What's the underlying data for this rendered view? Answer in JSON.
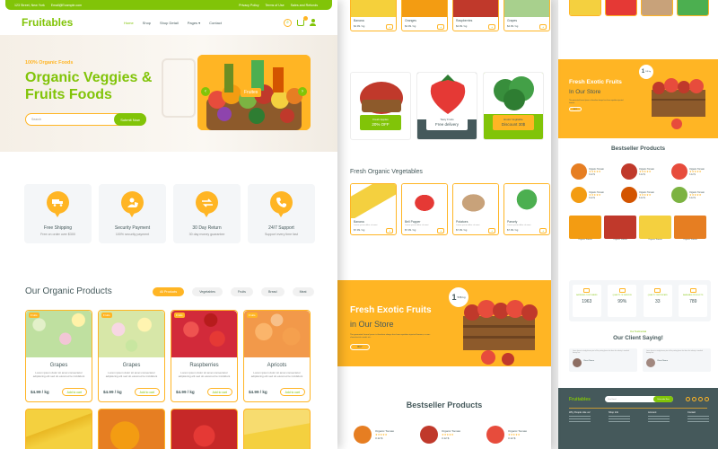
{
  "topbar": {
    "address": "123 Street, New York",
    "email": "Email@Example.com",
    "links": [
      "Privacy Policy",
      "Terms of Use",
      "Sales and Refunds"
    ]
  },
  "nav": {
    "logo": "Fruitables",
    "menu": [
      "Home",
      "Shop",
      "Shop Detail",
      "Pages ▾",
      "Contact"
    ],
    "cart_count": "3"
  },
  "hero": {
    "subtitle": "100% Organic Foods",
    "title": "Organic Veggies & Fruits Foods",
    "search_placeholder": "Search",
    "search_button": "Submit Now",
    "carousel_label": "Fruites"
  },
  "features": [
    {
      "title": "Free Shipping",
      "sub": "Free on order over $300",
      "icon": "truck-icon"
    },
    {
      "title": "Security Payment",
      "sub": "100% security payment",
      "icon": "user-shield-icon"
    },
    {
      "title": "30 Day Return",
      "sub": "30 day money guarantee",
      "icon": "exchange-icon"
    },
    {
      "title": "24/7 Support",
      "sub": "Support every time fast",
      "icon": "phone-icon"
    }
  ],
  "products_section": {
    "title": "Our Organic Products",
    "filters": [
      "All Products",
      "Vegetables",
      "Fruits",
      "Bread",
      "Meat"
    ]
  },
  "products": [
    {
      "tag": "Fruits",
      "name": "Grapes",
      "desc": "Lorem ipsum dolor sit amet consectetur adipisicing elit sed do eiusmod te incididunt",
      "price": "$4.99 / kg",
      "add": "Add to cart",
      "color": "#bfe0a0"
    },
    {
      "tag": "Fruits",
      "name": "Grapes",
      "desc": "Lorem ipsum dolor sit amet consectetur adipisicing elit sed do eiusmod te incididunt",
      "price": "$4.99 / kg",
      "add": "Add to cart",
      "color": "#d7e7a8"
    },
    {
      "tag": "Fruits",
      "name": "Raspberries",
      "desc": "Lorem ipsum dolor sit amet consectetur adipisicing elit sed do eiusmod te incididunt",
      "price": "$4.99 / kg",
      "add": "Add to cart",
      "color": "#d22a3a"
    },
    {
      "tag": "Fruits",
      "name": "Apricots",
      "desc": "Lorem ipsum dolor sit amet consectetur adipisicing elit sed do eiusmod te incididunt",
      "price": "$4.99 / kg",
      "add": "Add to cart",
      "color": "#f2994a"
    }
  ],
  "panel2": {
    "top_products": [
      {
        "name": "Banana",
        "price": "$4.99 / kg",
        "color": "#f5d03b"
      },
      {
        "name": "Oranges",
        "price": "$4.99 / kg",
        "color": "#f39c12"
      },
      {
        "name": "Raspberries",
        "price": "$4.99 / kg",
        "color": "#c0392b"
      },
      {
        "name": "Grapes",
        "price": "$4.99 / kg",
        "color": "#a8d08d"
      }
    ],
    "banners": [
      {
        "top": "Fresh Apples",
        "main": "20% OFF",
        "bg": "#ffffff",
        "lbl_bg": "#81c408",
        "lbl_color": "#ffffff",
        "fruit": "#c0392b"
      },
      {
        "top": "Tasty Fruits",
        "main": "Free delivery",
        "bg": "#45595b",
        "lbl_bg": "#ffffff",
        "lbl_color": "#45595b",
        "fruit": "#e74c3c"
      },
      {
        "top": "Exotic Vegitable",
        "main": "Discount 30$",
        "bg": "#81c408",
        "lbl_bg": "#ffb524",
        "lbl_color": "#45595b",
        "fruit": "#4caf50"
      }
    ],
    "veg_title": "Fresh Organic Vegetables",
    "veg": [
      {
        "name": "Banana",
        "price": "$7.99 / kg",
        "color": "#f4d03f"
      },
      {
        "name": "Bell Papper",
        "price": "$7.99 / kg",
        "color": "#e53935"
      },
      {
        "name": "Potatoes",
        "price": "$7.99 / kg",
        "color": "#c8a27a"
      },
      {
        "name": "Parsely",
        "price": "$7.99 / kg",
        "color": "#4caf50"
      }
    ],
    "exotic": {
      "title": "Fresh Exotic Fruits",
      "sub": "in Our Store",
      "btn": "BUY",
      "badge": "1",
      "badge_unit": "50$ kg"
    },
    "bestseller": "Bestseller Products",
    "best_items": [
      {
        "name": "Organic Tomato",
        "price": "3.12 $",
        "color": "#e67e22"
      },
      {
        "name": "Organic Tomato",
        "price": "3.12 $",
        "color": "#c0392b"
      },
      {
        "name": "Organic Tomato",
        "price": "3.12 $",
        "color": "#e74c3c"
      }
    ]
  },
  "panel3": {
    "exotic": {
      "title": "Fresh Exotic Fruits",
      "sub": "In Our Store",
      "btn": "BUY",
      "badge": "1",
      "badge_unit": "50$ kg"
    },
    "bestseller": "Bestseller Products",
    "list": [
      {
        "name": "Organic Tomato",
        "price": "3.12 $",
        "color": "#e67e22"
      },
      {
        "name": "Organic Tomato",
        "price": "3.12 $",
        "color": "#c0392b"
      },
      {
        "name": "Organic Tomato",
        "price": "3.12 $",
        "color": "#e74c3c"
      },
      {
        "name": "Organic Tomato",
        "price": "3.12 $",
        "color": "#f39c12"
      },
      {
        "name": "Organic Tomato",
        "price": "3.12 $",
        "color": "#d35400"
      },
      {
        "name": "Organic Tomato",
        "price": "3.12 $",
        "color": "#7cb342"
      }
    ],
    "tiles": [
      "#f39c12",
      "#c0392b",
      "#f4d03f",
      "#e67e22"
    ],
    "tile_label": "Organic Tomato",
    "stats": [
      {
        "label": "SATISFIED CUSTOMERS",
        "value": "1963"
      },
      {
        "label": "QUALITY OF SERVICE",
        "value": "99%"
      },
      {
        "label": "QUALITY CERTIFICATE",
        "value": "33"
      },
      {
        "label": "AVAILABLE PRODUCTS",
        "value": "789"
      }
    ],
    "testimonial_sub": "Our Testimonial",
    "testimonial_title": "Our Client Saying!",
    "clients": [
      {
        "name": "Client Name"
      },
      {
        "name": "Client Name"
      }
    ],
    "footer": {
      "logo": "Fruitables",
      "search": "Your Email",
      "btn": "Subscribe Now",
      "cols": [
        "Why People Like us!",
        "Shop Info",
        "Account",
        "Contact"
      ]
    }
  }
}
